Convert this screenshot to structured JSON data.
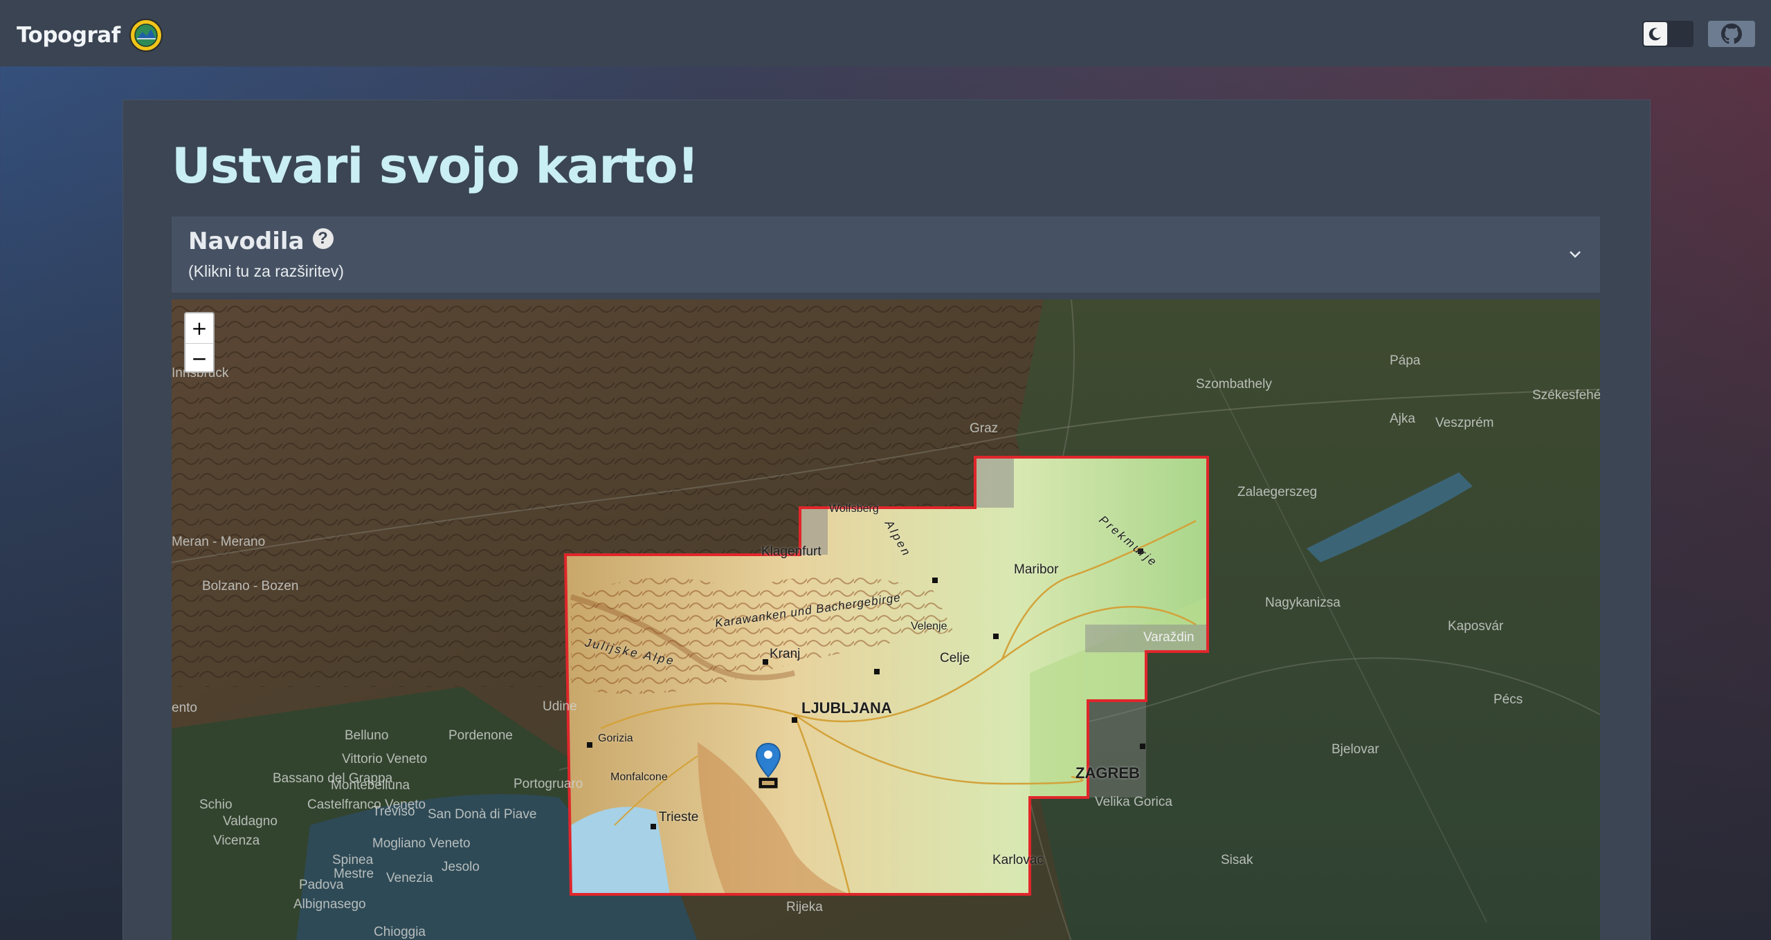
{
  "navbar": {
    "brand": "Topograf",
    "theme_toggle_icon": "moon-icon",
    "github_icon": "github-icon"
  },
  "page": {
    "title": "Ustvari svojo karto!"
  },
  "accordion": {
    "title": "Navodila",
    "help_icon": "?",
    "subtitle": "(Klikni tu za razširitev)"
  },
  "map": {
    "zoom_in": "+",
    "zoom_out": "−",
    "labels": {
      "innsbruck": "Innsbruck",
      "graz": "Graz",
      "szombathely": "Szombathely",
      "szekesfehervar": "Székesfehé",
      "veszprem": "Veszprém",
      "papa": "Pápa",
      "ajka": "Ajka",
      "zalaegerszeg": "Zalaegerszeg",
      "nagykanizsa": "Nagykanizsa",
      "kaposvar": "Kaposvár",
      "bolzano": "Bolzano - Bozen",
      "merano": "Meran - Merano",
      "udine": "Udine",
      "belluno": "Belluno",
      "pordenone": "Pordenone",
      "vittorio_veneto": "Vittorio Veneto",
      "montebelluna": "Montebelluna",
      "bassano": "Bassano del Grappa",
      "castelfranco": "Castelfranco Veneto",
      "treviso": "Treviso",
      "vicenza": "Vicenza",
      "padova": "Padova",
      "venezia": "Venezia",
      "chioggia": "Chioggia",
      "portogruaro": "Portogruaro",
      "san_dona": "San Donà di Piave",
      "mogliano": "Mogliano Veneto",
      "spinea": "Spinea",
      "mestre": "Mestre",
      "jesolo": "Jesolo",
      "albignasego": "Albignasego",
      "schio": "Schio",
      "valdagno": "Valdagno",
      "ento": "ento",
      "wolfsberg": "Wolfsberg",
      "klagenfurt": "Klagenfurt",
      "maribor": "Maribor",
      "velenje": "Velenje",
      "kranj": "Kranj",
      "celje": "Celje",
      "ljubljana": "LJUBLJANA",
      "gorizia": "Gorizia",
      "monfalcone": "Monfalcone",
      "trieste": "Trieste",
      "rijeka": "Rijeka",
      "karlovac": "Karlovac",
      "zagreb": "ZAGREB",
      "velika_gorica": "Velika Gorica",
      "sisak": "Sisak",
      "bjelovar": "Bjelovar",
      "varazdin": "Varaždin",
      "pecs": "Pécs",
      "karawanken": "Karawanken und Bachergebirge",
      "julijske": "Julijske Alpe",
      "prekmurje": "Prekmurje",
      "alpen": "Alpen"
    }
  },
  "colors": {
    "selection_outline": "#e0262b",
    "title": "#c9eef4",
    "marker": "#2b7fd0"
  }
}
